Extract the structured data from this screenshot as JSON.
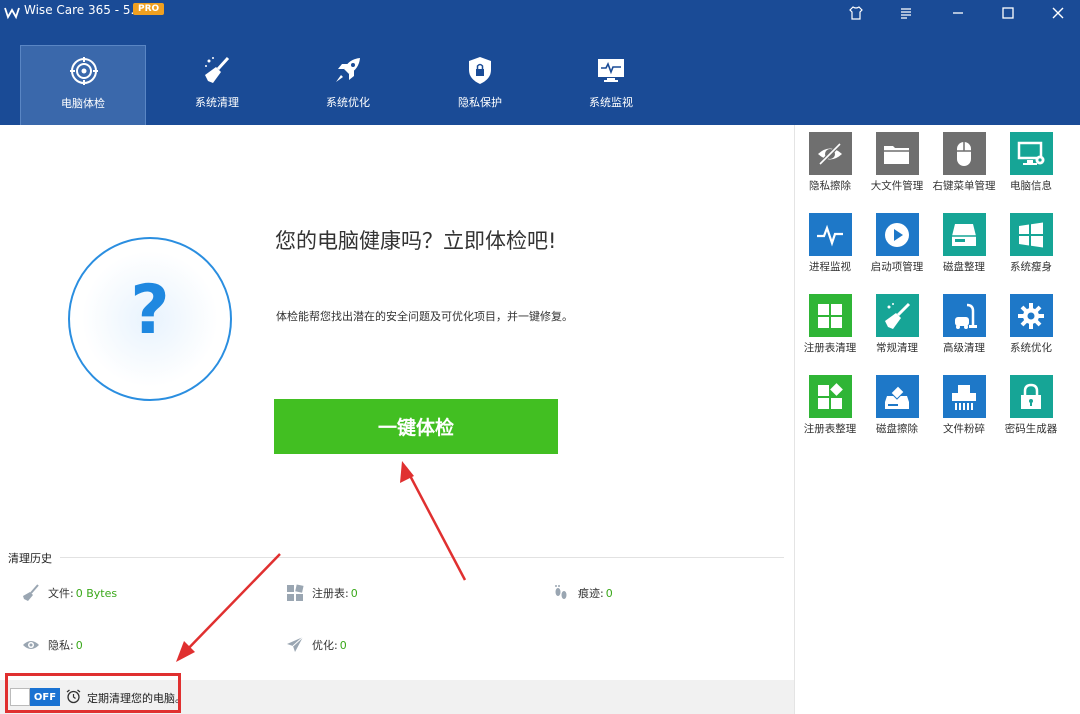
{
  "window": {
    "title": "Wise Care 365 - 5.8.3",
    "badge": "PRO",
    "controls": [
      "skin-icon",
      "menu-icon",
      "minimize-icon",
      "maximize-icon",
      "close-icon"
    ]
  },
  "nav": {
    "tabs": [
      {
        "label": "电脑体检",
        "icon": "target-icon",
        "active": true
      },
      {
        "label": "系统清理",
        "icon": "broom-icon",
        "active": false
      },
      {
        "label": "系统优化",
        "icon": "rocket-icon",
        "active": false
      },
      {
        "label": "隐私保护",
        "icon": "shield-lock-icon",
        "active": false
      },
      {
        "label": "系统监视",
        "icon": "monitor-pulse-icon",
        "active": false
      }
    ]
  },
  "main": {
    "headline": "您的电脑健康吗？立即体检吧!",
    "subtext": "体检能帮您找出潜在的安全问题及可优化项目，并一键修复。",
    "question_mark": "?",
    "scan_button": "一键体检"
  },
  "history": {
    "title": "清理历史",
    "stats": [
      {
        "label": "文件:",
        "value": "0 Bytes",
        "icon": "broom-icon"
      },
      {
        "label": "注册表:",
        "value": "0",
        "icon": "registry-icon"
      },
      {
        "label": "痕迹:",
        "value": "0",
        "icon": "footprint-icon"
      },
      {
        "label": "隐私:",
        "value": "0",
        "icon": "eye-icon"
      },
      {
        "label": "优化:",
        "value": "0",
        "icon": "paper-plane-icon"
      }
    ]
  },
  "footer": {
    "toggle_state": "OFF",
    "schedule_text": "定期清理您的电脑。"
  },
  "tools": [
    {
      "label": "隐私擦除",
      "icon": "eye-slash-icon",
      "color": "#6f6f6f"
    },
    {
      "label": "大文件管理",
      "icon": "folder-icon",
      "color": "#6f6f6f"
    },
    {
      "label": "右键菜单管理",
      "icon": "mouse-icon",
      "color": "#6f6f6f"
    },
    {
      "label": "电脑信息",
      "icon": "computer-gear-icon",
      "color": "#16a596"
    },
    {
      "label": "进程监视",
      "icon": "pulse-icon",
      "color": "#1e78c8"
    },
    {
      "label": "启动项管理",
      "icon": "play-icon",
      "color": "#1e78c8"
    },
    {
      "label": "磁盘整理",
      "icon": "disk-icon",
      "color": "#16a596"
    },
    {
      "label": "系统瘦身",
      "icon": "windows-icon",
      "color": "#16a596"
    },
    {
      "label": "注册表清理",
      "icon": "registry-icon",
      "color": "#2fb536"
    },
    {
      "label": "常规清理",
      "icon": "broom-icon",
      "color": "#16a596"
    },
    {
      "label": "高级清理",
      "icon": "vacuum-icon",
      "color": "#1e78c8"
    },
    {
      "label": "系统优化",
      "icon": "gear-icon",
      "color": "#1e78c8"
    },
    {
      "label": "注册表整理",
      "icon": "registry-defrag-icon",
      "color": "#2fb536"
    },
    {
      "label": "磁盘擦除",
      "icon": "disk-eraser-icon",
      "color": "#1e78c8"
    },
    {
      "label": "文件粉碎",
      "icon": "shredder-icon",
      "color": "#1e78c8"
    },
    {
      "label": "密码生成器",
      "icon": "padlock-icon",
      "color": "#16a596"
    }
  ]
}
